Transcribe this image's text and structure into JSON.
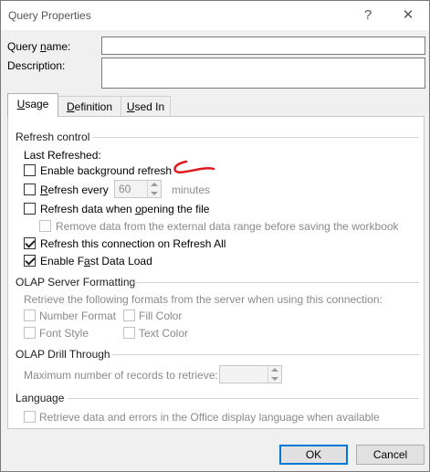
{
  "dialog": {
    "title": "Query Properties",
    "help_glyph": "?",
    "close_glyph": "✕"
  },
  "query_name": {
    "label": "Query name:",
    "value": ""
  },
  "description": {
    "label": "Description:",
    "value": ""
  },
  "tabs": [
    {
      "label": "Usage",
      "active": true
    },
    {
      "label": "Definition",
      "active": false
    },
    {
      "label": "Used In",
      "active": false
    }
  ],
  "refresh_control": {
    "heading": "Refresh control",
    "last_refreshed": "Last Refreshed:",
    "enable_background_refresh": {
      "label": "Enable background refresh",
      "checked": false
    },
    "refresh_every": {
      "label": "Refresh every",
      "checked": false,
      "value": "60",
      "unit": "minutes"
    },
    "refresh_on_open": {
      "label": "Refresh data when opening the file",
      "checked": false
    },
    "remove_data": {
      "label": "Remove data from the external data range before saving the workbook",
      "checked": false,
      "disabled": true
    },
    "refresh_all": {
      "label": "Refresh this connection on Refresh All",
      "checked": true
    },
    "fast_data_load": {
      "label": "Enable Fast Data Load",
      "checked": true
    }
  },
  "olap_formatting": {
    "heading": "OLAP Server Formatting",
    "description": "Retrieve the following formats from the server when using this connection:",
    "number_format": "Number Format",
    "fill_color": "Fill Color",
    "font_style": "Font Style",
    "text_color": "Text Color"
  },
  "olap_drill": {
    "heading": "OLAP Drill Through",
    "max_records_label": "Maximum number of records to retrieve:",
    "max_records_value": ""
  },
  "language": {
    "heading": "Language",
    "retrieve_label": "Retrieve data and errors in the Office display language when available"
  },
  "buttons": {
    "ok": "OK",
    "cancel": "Cancel"
  },
  "annotation": {
    "color": "#e0191f"
  }
}
